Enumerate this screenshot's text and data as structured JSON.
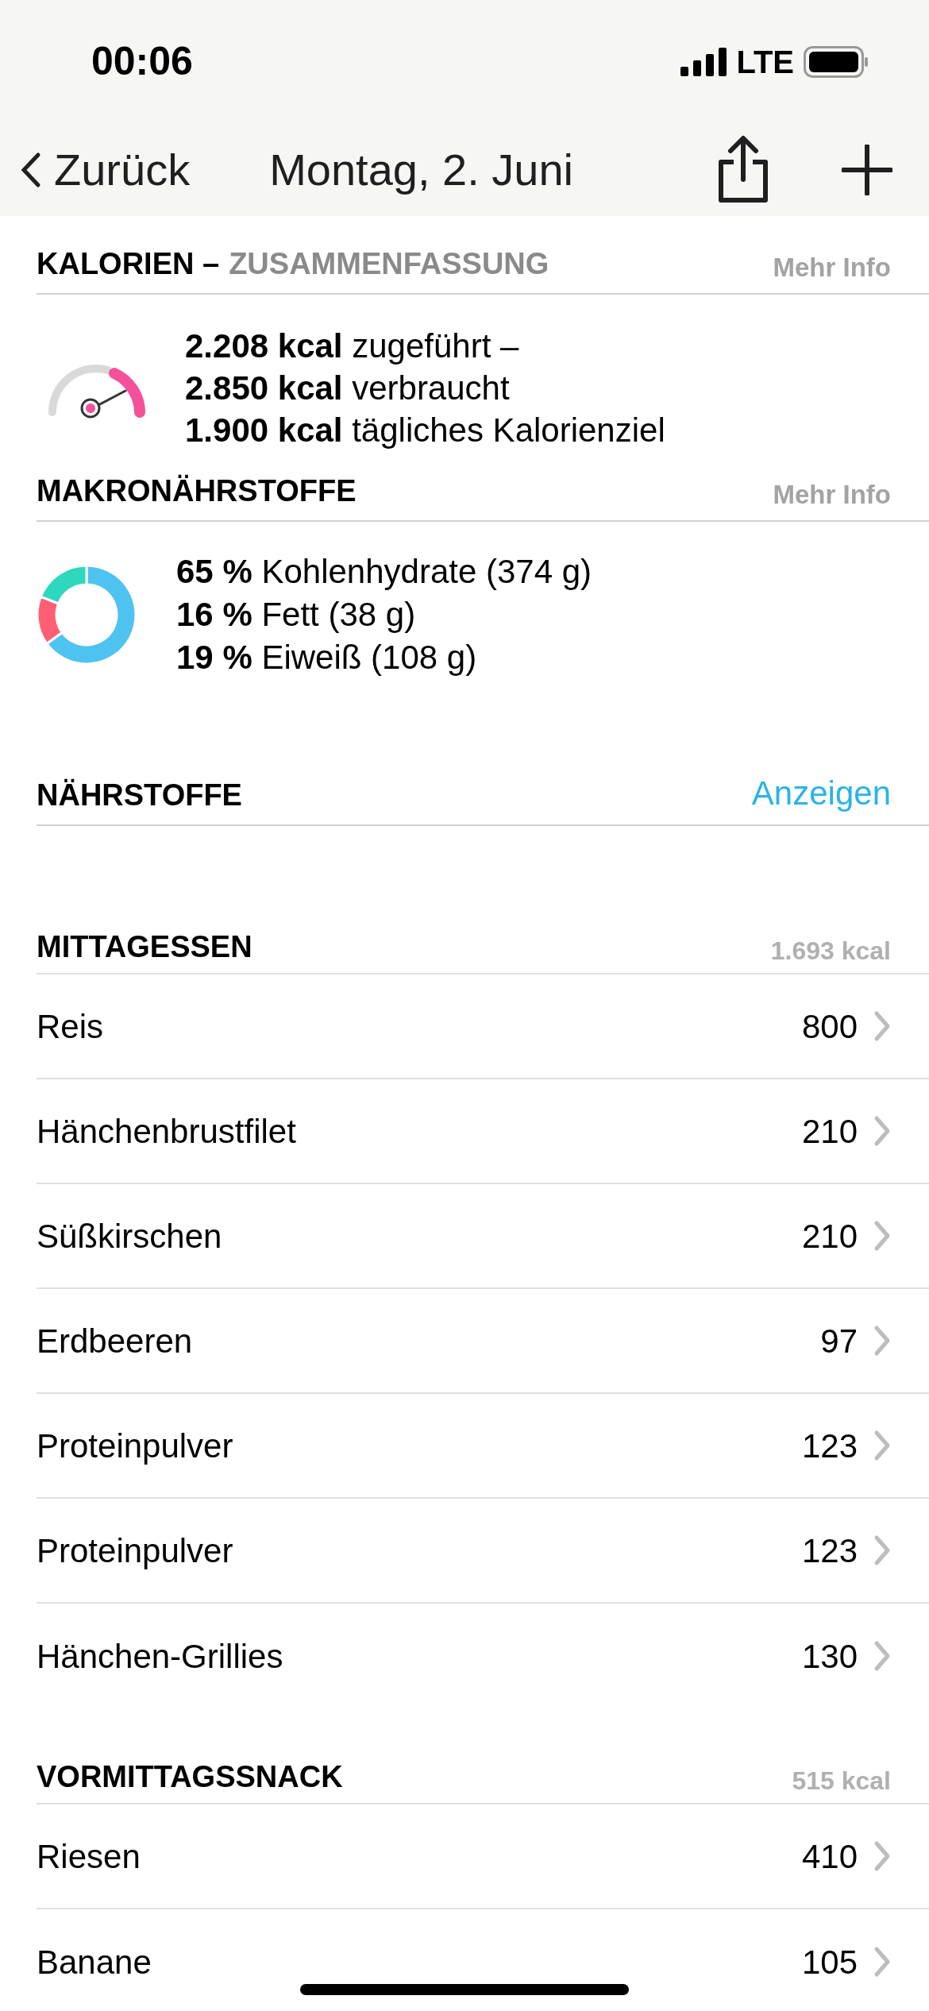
{
  "status_bar": {
    "time": "00:06",
    "network": "LTE"
  },
  "nav": {
    "back": "Zurück",
    "title": "Montag, 2. Juni"
  },
  "calories": {
    "title": "KALORIEN –",
    "subtitle": "ZUSAMMENFASSUNG",
    "link": "Mehr Info",
    "lines": [
      "**2.208 kcal** zugeführt –",
      "**2.850 kcal** verbraucht",
      "**1.900 kcal** tägliches Kalorienziel"
    ]
  },
  "macros": {
    "title": "MAKRONÄHRSTOFFE",
    "link": "Mehr Info",
    "items": [
      {
        "percent": "65 %",
        "name": "Kohlenhydrate",
        "amount": "(374 g)"
      },
      {
        "percent": "16 %",
        "name": "Fett",
        "amount": "(38 g)"
      },
      {
        "percent": "19 %",
        "name": "Eiweiß",
        "amount": "(108 g)"
      }
    ],
    "chart_data": {
      "type": "donut",
      "values": [
        65,
        16,
        19
      ]
    }
  },
  "nutrients": {
    "title": "NÄHRSTOFFE",
    "link": "Anzeigen"
  },
  "meals": [
    {
      "title": "MITTAGESSEN",
      "total": "1.693 kcal",
      "items": [
        {
          "name": "Reis",
          "kcal": "800"
        },
        {
          "name": "Hänchenbrustfilet",
          "kcal": "210"
        },
        {
          "name": "Süßkirschen",
          "kcal": "210"
        },
        {
          "name": "Erdbeeren",
          "kcal": "97"
        },
        {
          "name": "Proteinpulver",
          "kcal": "123"
        },
        {
          "name": "Proteinpulver",
          "kcal": "123"
        },
        {
          "name": "Hänchen-Grillies",
          "kcal": "130"
        }
      ]
    },
    {
      "title": "VORMITTAGSSNACK",
      "total": "515 kcal",
      "items": [
        {
          "name": "Riesen",
          "kcal": "410"
        },
        {
          "name": "Banane",
          "kcal": "105"
        }
      ]
    }
  ]
}
